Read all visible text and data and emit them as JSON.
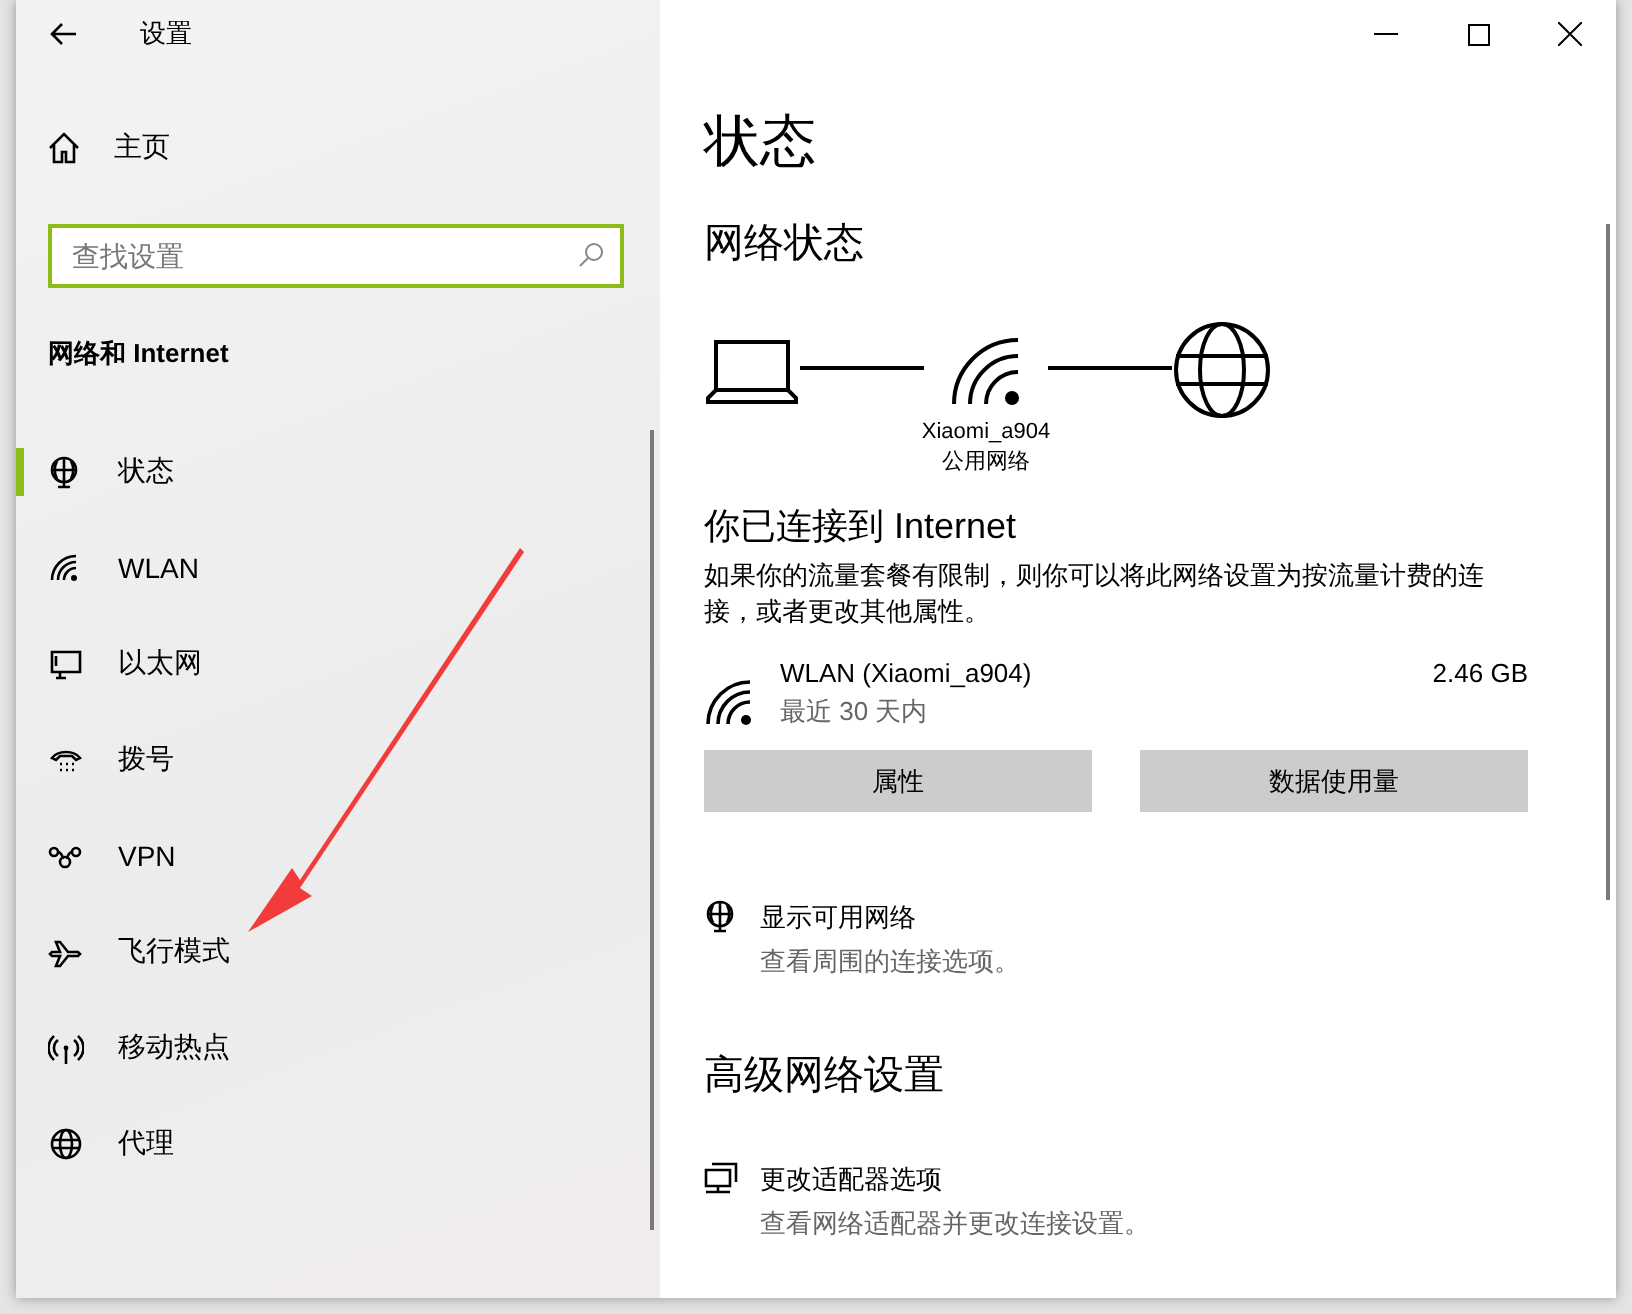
{
  "window": {
    "title": "设置"
  },
  "sidebar": {
    "home": "主页",
    "search": {
      "placeholder": "查找设置"
    },
    "section": "网络和 Internet",
    "items": [
      {
        "kind": "status",
        "label": "状态",
        "selected": true
      },
      {
        "kind": "wifi",
        "label": "WLAN",
        "selected": false
      },
      {
        "kind": "ethernet",
        "label": "以太网",
        "selected": false
      },
      {
        "kind": "dialup",
        "label": "拨号",
        "selected": false
      },
      {
        "kind": "vpn",
        "label": "VPN",
        "selected": false
      },
      {
        "kind": "airplane",
        "label": "飞行模式",
        "selected": false
      },
      {
        "kind": "hotspot",
        "label": "移动热点",
        "selected": false
      },
      {
        "kind": "globe",
        "label": "代理",
        "selected": false
      }
    ]
  },
  "main": {
    "title": "状态",
    "network_status": {
      "heading": "网络状态",
      "network_name": "Xiaomi_a904",
      "network_type": "公用网络"
    },
    "connected": {
      "heading": "你已连接到 Internet",
      "description": "如果你的流量套餐有限制，则你可以将此网络设置为按流量计费的连接，或者更改其他属性。",
      "connection": {
        "name": "WLAN (Xiaomi_a904)",
        "period": "最近 30 天内",
        "usage": "2.46 GB"
      },
      "buttons": [
        "属性",
        "数据使用量"
      ]
    },
    "links": [
      {
        "kind": "status",
        "title": "显示可用网络",
        "subtitle": "查看周围的连接选项。"
      }
    ],
    "advanced": {
      "heading": "高级网络设置",
      "links": [
        {
          "kind": "adapter",
          "title": "更改适配器选项",
          "subtitle": "查看网络适配器并更改连接设置。"
        }
      ]
    }
  }
}
